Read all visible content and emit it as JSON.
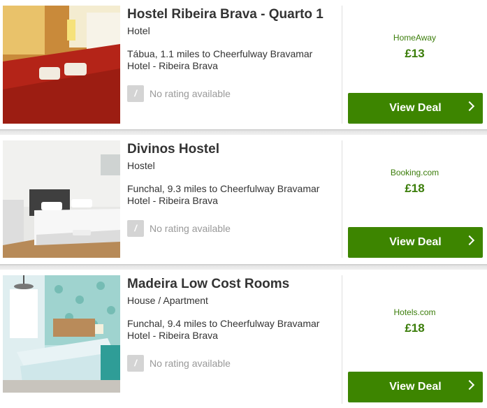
{
  "listings": [
    {
      "title": "Hostel Ribeira Brava - Quarto 1",
      "type": "Hotel",
      "location_line1": "Tábua, 1.1 miles to Cheerfulway Bravamar",
      "location_line2": "Hotel - Ribeira Brava",
      "rating_badge": "/",
      "rating_text": "No rating available",
      "provider": "HomeAway",
      "price": "£13",
      "button_label": "View Deal"
    },
    {
      "title": "Divinos Hostel",
      "type": "Hostel",
      "location_line1": "Funchal, 9.3 miles to Cheerfulway Bravamar",
      "location_line2": "Hotel - Ribeira Brava",
      "rating_badge": "/",
      "rating_text": "No rating available",
      "provider": "Booking.com",
      "price": "£18",
      "button_label": "View Deal"
    },
    {
      "title": "Madeira Low Cost Rooms",
      "type": "House / Apartment",
      "location_line1": "Funchal, 9.4 miles to Cheerfulway Bravamar",
      "location_line2": "Hotel - Ribeira Brava",
      "rating_badge": "/",
      "rating_text": "No rating available",
      "provider": "Hotels.com",
      "price": "£18",
      "button_label": "View Deal"
    }
  ],
  "colors": {
    "accent_green": "#3d8500",
    "price_green": "#3b7d0a",
    "rating_gray": "#d4d4d4"
  },
  "icons": [
    "chevron-right-icon",
    "no-rating-icon"
  ]
}
